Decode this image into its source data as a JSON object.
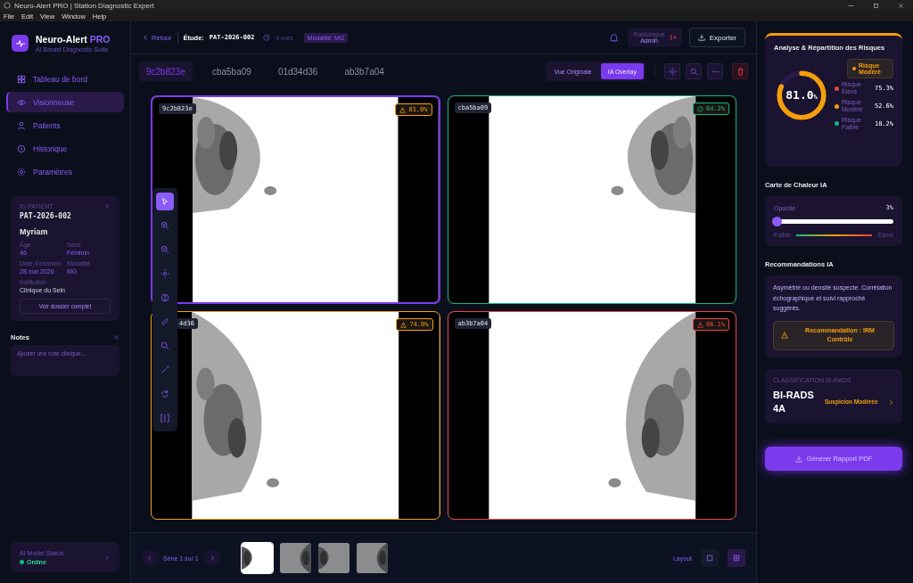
{
  "window": {
    "title": "Neuro-Alert PRO | Station Diagnostic Expert"
  },
  "menu": [
    "File",
    "Edit",
    "View",
    "Window",
    "Help"
  ],
  "brand": {
    "name": "Neuro-Alert",
    "badge": "PRO",
    "tagline": "AI Breast Diagnostic Suite"
  },
  "nav": [
    {
      "label": "Tableau de bord",
      "selected": false
    },
    {
      "label": "Visionneuse",
      "selected": true
    },
    {
      "label": "Patients",
      "selected": false
    },
    {
      "label": "Historique",
      "selected": false
    },
    {
      "label": "Paramètres",
      "selected": false
    }
  ],
  "patient": {
    "id_label": "ID PATIENT",
    "id": "PAT-2026-002",
    "name": "Myriam",
    "fields": [
      {
        "label": "Âge",
        "value": "46"
      },
      {
        "label": "Sexe",
        "value": "Féminin"
      },
      {
        "label": "Date d'examen",
        "value": "28 mai 2026"
      },
      {
        "label": "Modalité",
        "value": "MG"
      }
    ],
    "institution_label": "Institution",
    "institution": "Clinique du Sein",
    "button": "Voir dossier complet"
  },
  "notes": {
    "title": "Notes",
    "placeholder": "Ajouter une note clinique..."
  },
  "ai_status": {
    "label": "AI Model Status",
    "status": "Online"
  },
  "header": {
    "back": "Retour",
    "study_label": "Étude:",
    "study_id": "PAT-2026-002",
    "views": "4 vues",
    "modality": "Modalité: MG",
    "user_role": "Radiologue",
    "user_name": "Admin",
    "export": "Exporter"
  },
  "study_tabs": [
    {
      "label": "9c2b823e",
      "selected": true
    },
    {
      "label": "cba5ba09",
      "selected": false
    },
    {
      "label": "01d34d36",
      "selected": false
    },
    {
      "label": "ab3b7a04",
      "selected": false
    }
  ],
  "view_toggle": [
    {
      "label": "Vue Originale",
      "selected": false
    },
    {
      "label": "IA Overlay",
      "selected": true
    }
  ],
  "images": [
    {
      "label": "9c2b823e",
      "risk": "81.0%",
      "kind": "warning",
      "color": "#f59e0b",
      "selected": true
    },
    {
      "label": "cba5ba09",
      "risk": "64.2%",
      "kind": "ok",
      "color": "#10b981",
      "selected": false
    },
    {
      "label": "4d36",
      "risk": "74.0%",
      "kind": "warning",
      "color": "#f59e0b",
      "selected": false
    },
    {
      "label": "ab3b7a04",
      "risk": "86.1%",
      "kind": "warning",
      "color": "#ef4444",
      "selected": false
    }
  ],
  "tools": [
    {
      "selected": true
    },
    {
      "selected": false
    },
    {
      "selected": false
    },
    {
      "selected": false
    },
    {
      "selected": false
    },
    {
      "selected": false
    },
    {
      "selected": false
    },
    {
      "selected": false
    },
    {
      "selected": false
    },
    {
      "selected": false
    }
  ],
  "series": {
    "label": "Série 1 sur 1",
    "thumbnails": [
      {
        "selected": true
      },
      {
        "selected": false
      },
      {
        "selected": false
      },
      {
        "selected": false
      }
    ]
  },
  "layout": {
    "label": "Layout",
    "options": [
      {
        "selected": false
      },
      {
        "selected": true
      }
    ]
  },
  "risk_card": {
    "title": "Analyse & Répartition des Risques",
    "score": "81.0",
    "unit": "%",
    "tag": "Risque Modéré",
    "items": [
      {
        "label": "Risque Élevé",
        "value": "75.3%",
        "color": "#ef4444"
      },
      {
        "label": "Risque Modéré",
        "value": "52.6%",
        "color": "#f59e0b"
      },
      {
        "label": "Risque Faible",
        "value": "18.2%",
        "color": "#10b981"
      }
    ]
  },
  "heatmap": {
    "title": "Carte de Chaleur IA",
    "opacity_label": "Opacité",
    "opacity_value": "3%",
    "level": 0.03,
    "low": "Faible",
    "high": "Élevé"
  },
  "recommendations": {
    "title": "Recommandations IA",
    "text": "Asymétrie ou densité suspecte. Corrélation échographique et suivi rapproché suggérés.",
    "alert": "Recommandation : IRM Contrôle"
  },
  "birads": {
    "label": "CLASSIFICATION BI-RADS",
    "value": "BI-RADS 4A",
    "desc": "Suspicion Modérée"
  },
  "report_button": "Générer Rapport PDF"
}
